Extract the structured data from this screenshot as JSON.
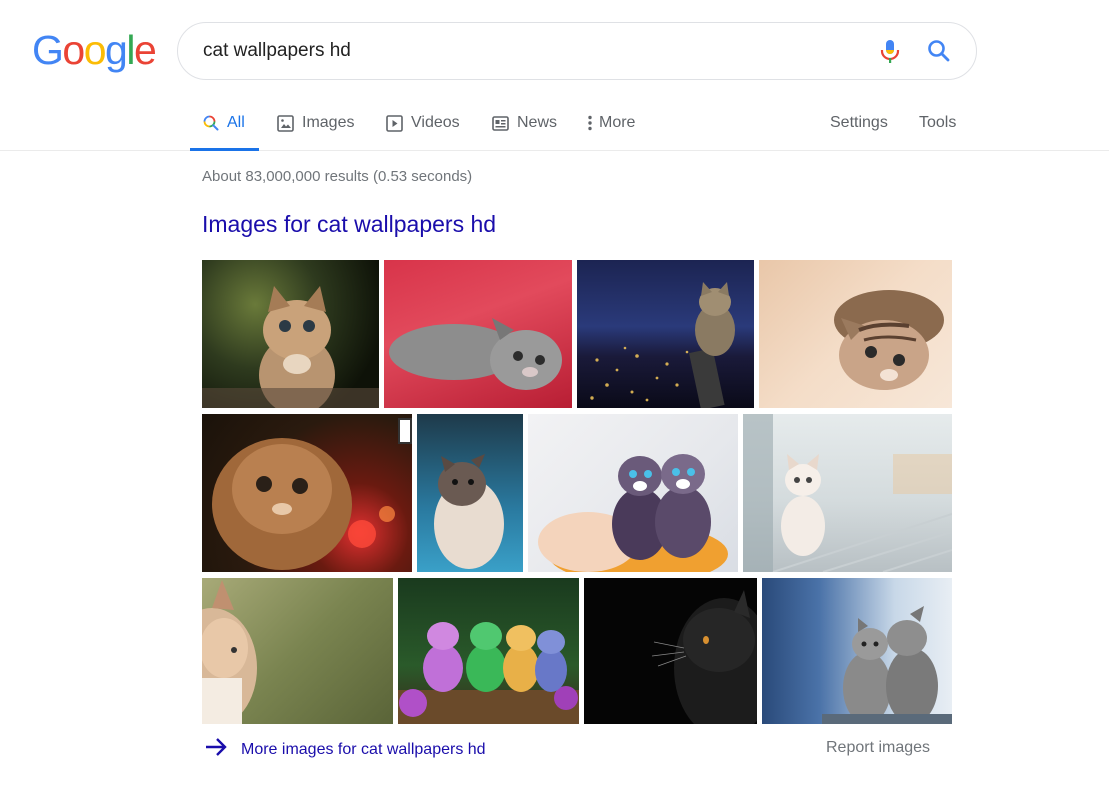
{
  "logo": {
    "letters": [
      "G",
      "o",
      "o",
      "g",
      "l",
      "e"
    ],
    "colors": [
      "#4285F4",
      "#EA4335",
      "#FBBC05",
      "#4285F4",
      "#34A853",
      "#EA4335"
    ]
  },
  "search": {
    "query": "cat wallpapers hd",
    "mic_icon": "microphone-icon",
    "search_icon": "magnifier-icon"
  },
  "tabs": [
    {
      "label": "All",
      "icon": "search-icon",
      "active": true
    },
    {
      "label": "Images",
      "icon": "image-icon"
    },
    {
      "label": "Videos",
      "icon": "play-icon"
    },
    {
      "label": "News",
      "icon": "newspaper-icon"
    },
    {
      "label": "More",
      "icon": "vertical-dots-icon"
    },
    {
      "label": "Settings"
    },
    {
      "label": "Tools"
    }
  ],
  "result_stats": "About 83,000,000 results (0.53 seconds)",
  "images_section": {
    "title": "Images for cat wallpapers hd",
    "more_link": "More images for cat wallpapers hd",
    "report": "Report images"
  },
  "colors": {
    "link": "#1a0dab",
    "accent": "#1a73e8",
    "muted": "#70757a"
  }
}
